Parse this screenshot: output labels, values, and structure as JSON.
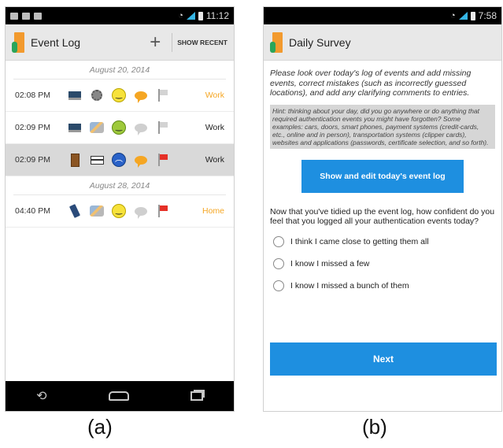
{
  "panel_a": {
    "status_time": "11:12",
    "app_title": "Event Log",
    "plus_label": "+",
    "show_recent": "SHOW RECENT",
    "date1": "August 20, 2014",
    "date2": "August 28, 2014",
    "rows": [
      {
        "time": "02:08 PM",
        "tag": "Work",
        "tag_color": "#f5a623",
        "bubble": "orange",
        "flag": "grey",
        "mood": "happy"
      },
      {
        "time": "02:09 PM",
        "tag": "Work",
        "tag_color": "#222222",
        "bubble": "grey",
        "flag": "grey",
        "mood": "green"
      },
      {
        "time": "02:09 PM",
        "tag": "Work",
        "tag_color": "#222222",
        "bubble": "orange",
        "flag": "red",
        "mood": "sad"
      },
      {
        "time": "04:40 PM",
        "tag": "Home",
        "tag_color": "#f5a623",
        "bubble": "grey",
        "flag": "red",
        "mood": "happy"
      }
    ],
    "nav": {
      "back": "back-icon",
      "home": "home-icon",
      "recent": "recent-apps-icon"
    }
  },
  "panel_b": {
    "status_time": "7:58",
    "app_title": "Daily Survey",
    "intro": "Please look over today's log of events and add missing events, correct mistakes (such as incorrectly guessed locations), and add any clarifying comments to entries.",
    "hint": "Hint: thinking about your day, did you go anywhere or do anything that required authentication events you might have forgotten? Some examples: cars, doors, smart phones, payment systems (credit-cards, etc., online and in person), transportation systems (clipper cards), websites and applications (passwords, certificate selection, and so forth).",
    "show_button": "Show and edit today's event log",
    "question": "Now that you've tidied up the event log, how confident do you feel that you logged all your authentication events today?",
    "options": [
      "I think I came close to getting them all",
      "I know I missed a few",
      "I know I missed a bunch of them"
    ],
    "next_button": "Next"
  },
  "captions": {
    "a": "(a)",
    "b": "(b)"
  },
  "colors": {
    "accent": "#1e8fe0",
    "work_tag": "#f5a623",
    "flag_red": "#e53027"
  }
}
